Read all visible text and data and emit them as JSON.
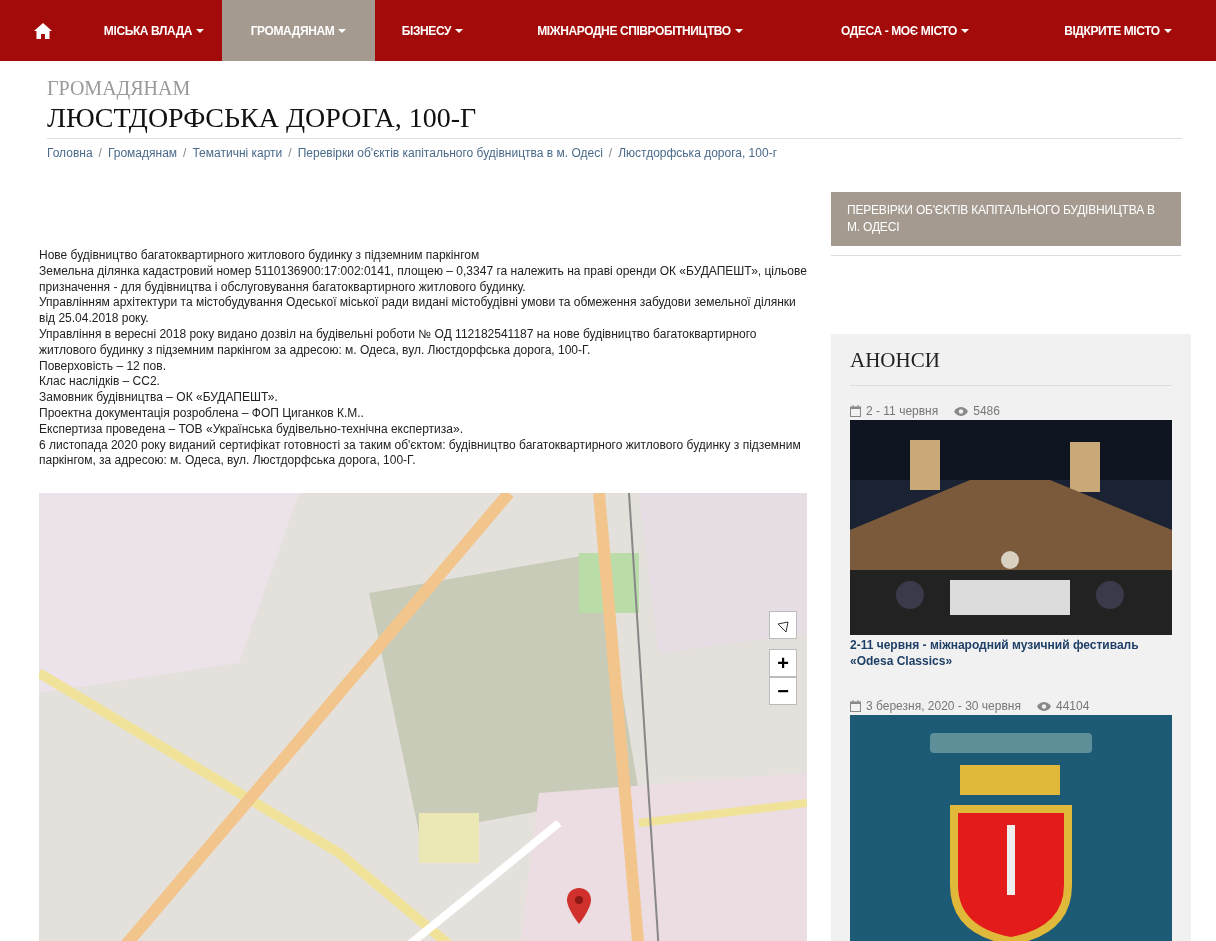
{
  "nav": [
    {
      "kind": "home",
      "selected": false
    },
    {
      "kind": "menu",
      "label": "МІСЬКА ВЛАДА",
      "selected": false
    },
    {
      "kind": "menu",
      "label": "ГРОМАДЯНАМ",
      "selected": true
    },
    {
      "kind": "menu",
      "label": "БІЗНЕСУ",
      "selected": false
    },
    {
      "kind": "menu",
      "label": "МІЖНАРОДНЕ СПІВРОБІТНИЦТВО",
      "selected": false
    },
    {
      "kind": "menu",
      "label": "ОДЕСА - МОЄ МІСТО",
      "selected": false
    },
    {
      "kind": "menu",
      "label": "ВІДКРИТЕ МІСТО",
      "selected": false
    }
  ],
  "section": "ГРОМАДЯНАМ",
  "title": "ЛЮСТДОРФСЬКА ДОРОГА, 100-Г",
  "breadcrumb": [
    {
      "label": "Головна"
    },
    {
      "separator": "/",
      "label": "Громадянам"
    },
    {
      "separator": "/",
      "label": "Тематичні карти"
    },
    {
      "separator": "/",
      "label": "Перевірки об'єктів капітального будівництва в м. Одесі"
    },
    {
      "separator": "/",
      "label": "Люстдорфська дорога, 100-г"
    }
  ],
  "paragraphs": [
    "Нове будівництво багатоквартирного житлового будинку з підземним паркінгом",
    "Земельна ділянка кадастровий номер 5110136900:17:002:0141, площею – 0,3347 га належить на праві оренди ОК «БУДАПЕШТ», цільове призначення - для будівництва і обслуговування багатоквартирного житлового будинку.",
    "Управлінням архітектури та містобудування Одеської міської ради видані містобудівні умови та обмеження забудови земельної ділянки від 25.04.2018 року.",
    "Управління в вересні 2018 року видано дозвіл на будівельні роботи № ОД 112182541187 на нове будівництво багатоквартирного житлового будинку з підземним паркінгом за адресою: м. Одеса, вул. Люстдорфська дорога, 100-Г.",
    "Поверховість – 12 пов.",
    "Клас наслідків – СС2.",
    "Замовник будівництва – ОК «БУДАПЕШТ».",
    "Проектна документація розроблена – ФОП Циганков К.М..",
    "Експертиза проведена – ТОВ «Українська будівельно-технічна експертиза».",
    "6 листопада 2020 року виданий сертифікат готовності за таким об'єктом: будівництво   багатоквартирного житлового будинку з підземним паркінгом, за адресою: м. Одеса, вул. Люстдорфська дорога, 100-Г."
  ],
  "map": {
    "kind": "picture",
    "zoom_in": "+",
    "zoom_out": "−"
  },
  "sidebar": {
    "items": [
      {
        "label": "ПЕРЕВІРКИ ОБ'ЄКТІВ КАПІТАЛЬНОГО БУДІВНИЦТВА В М. ОДЕСІ",
        "selected": true
      }
    ]
  },
  "announcements": {
    "title": "АНОНСИ",
    "items": [
      {
        "date": "2 - 11 червня",
        "views": "5486",
        "title": "2-11 червня - міжнародний музичний фестиваль «Odesa Classics»"
      },
      {
        "date": "3 березня, 2020 - 30 червня",
        "views": "44104"
      }
    ]
  }
}
